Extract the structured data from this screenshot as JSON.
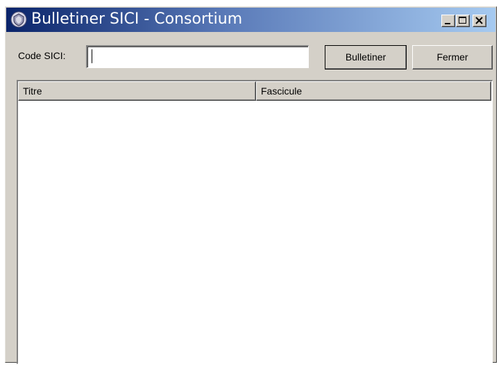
{
  "window": {
    "title": "Bulletiner SICI - Consortium",
    "icon": "app-shield-icon",
    "controls": {
      "minimize": "minimize-icon",
      "maximize": "maximize-icon",
      "close": "close-icon"
    }
  },
  "form": {
    "code_label": "Code SICI:",
    "code_value": "",
    "bulletiner_label": "Bulletiner",
    "fermer_label": "Fermer"
  },
  "table": {
    "columns": [
      "Titre",
      "Fascicule"
    ],
    "rows": []
  },
  "colors": {
    "titlebar_start": "#0a246a",
    "titlebar_end": "#a6caf0",
    "face": "#d4d0c8"
  }
}
